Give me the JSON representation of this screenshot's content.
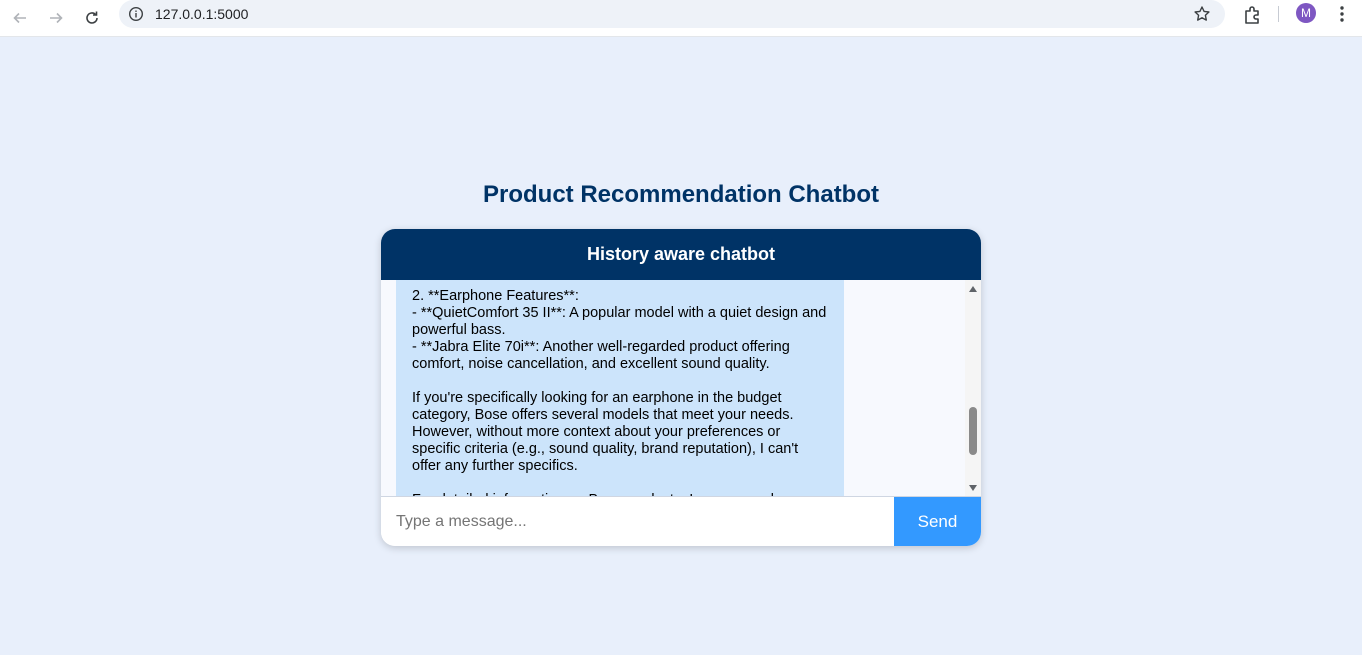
{
  "browser": {
    "url": "127.0.0.1:5000",
    "profile_initial": "M"
  },
  "page": {
    "title": "Product Recommendation Chatbot"
  },
  "chat": {
    "header": "History aware chatbot",
    "message_text": "2. **Earphone Features**:\n- **QuietComfort 35 II**: A popular model with a quiet design and powerful bass.\n- **Jabra Elite 70i**: Another well-regarded product offering comfort, noise cancellation, and excellent sound quality.\n\nIf you're specifically looking for an earphone in the budget category, Bose offers several models that meet your needs. However, without more context about your preferences or specific criteria (e.g., sound quality, brand reputation), I can't offer any further specifics.\n\nFor detailed information on Bose products, I recommend",
    "input_placeholder": "Type a message...",
    "send_label": "Send"
  },
  "colors": {
    "header_bg": "#003366",
    "bubble_bg": "#cce4fb",
    "send_bg": "#3399ff",
    "page_bg": "#e8effb"
  }
}
